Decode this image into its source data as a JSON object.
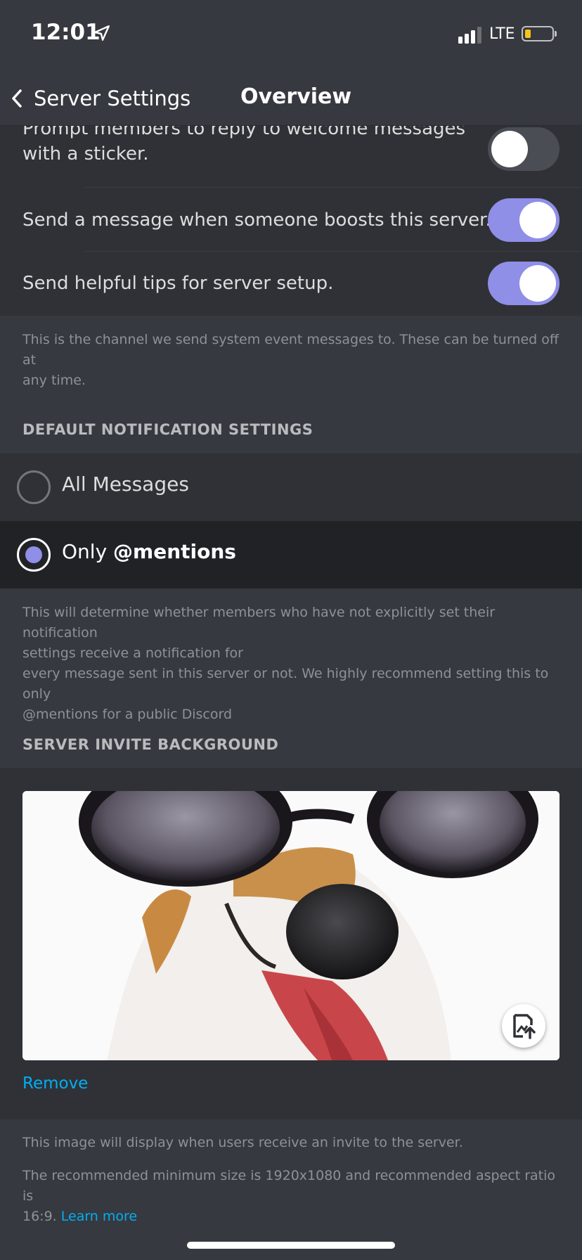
{
  "status_bar": {
    "time": "12:01",
    "network": "LTE"
  },
  "nav": {
    "back_label": "Server Settings",
    "title": "Overview"
  },
  "system_messages": {
    "items": [
      {
        "label_line1": "Prompt members to reply to welcome messages",
        "label_line2": "with a sticker.",
        "enabled": false
      },
      {
        "label": "Send a message when someone boosts this server.",
        "enabled": true
      },
      {
        "label": "Send helpful tips for server setup.",
        "enabled": true
      }
    ],
    "note_line1": "This is the channel we send system event messages to. These can be turned off at",
    "note_line2": "any time."
  },
  "notifications": {
    "section_title": "DEFAULT NOTIFICATION SETTINGS",
    "options": [
      {
        "label": "All Messages",
        "selected": false
      },
      {
        "label_prefix": "Only ",
        "label_bold": "@mentions",
        "selected": true
      }
    ],
    "note_line1": "This will determine whether members who have not explicitly set their notification",
    "note_line2": "settings receive a notification for",
    "note_line3": "every message sent in this server or not. We highly recommend setting this to only",
    "note_line4": "@mentions for a public Discord"
  },
  "invite_background": {
    "section_title": "SERVER INVITE BACKGROUND",
    "image_icon": "image-upload-icon",
    "remove_label": "Remove",
    "note_line1": "This image will display when users receive an invite to the server.",
    "note_line2": "The recommended minimum size is 1920x1080 and recommended aspect ratio is",
    "note_line3_prefix": "16:9. ",
    "learn_more": "Learn more"
  },
  "colors": {
    "accent": "#8f8fe8",
    "link": "#00aff4",
    "background": "#36393f",
    "row": "#2f3136"
  }
}
